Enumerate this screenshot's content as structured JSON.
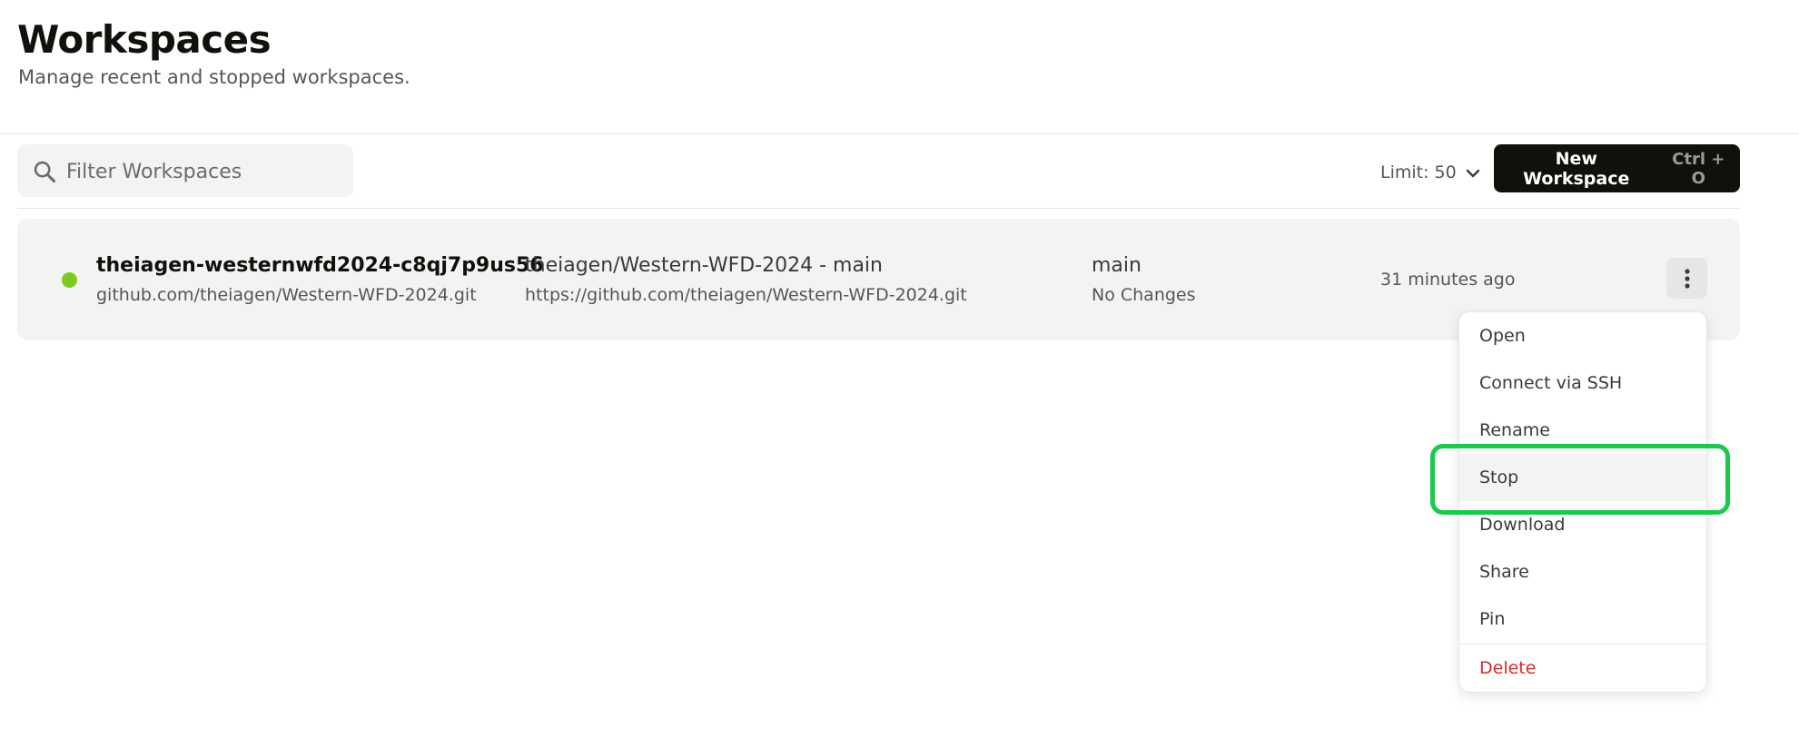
{
  "header": {
    "title": "Workspaces",
    "subtitle": "Manage recent and stopped workspaces."
  },
  "toolbar": {
    "filter_placeholder": "Filter Workspaces",
    "filter_icon": "search-icon",
    "limit_label": "Limit: 50",
    "limit_icon": "chevron-down-icon",
    "new_workspace_label": "New Workspace",
    "new_workspace_shortcut": "Ctrl + O"
  },
  "workspaces": [
    {
      "status": "running",
      "status_color": "#7ecb20",
      "name": "theiagen-westernwfd2024-c8qj7p9us56",
      "repo_url": "github.com/theiagen/Western-WFD-2024.git",
      "context": "theiagen/Western-WFD-2024 - main",
      "context_url": "https://github.com/theiagen/Western-WFD-2024.git",
      "branch": "main",
      "changes": "No Changes",
      "last_active": "31 minutes ago",
      "more_icon": "vertical-ellipsis-icon"
    }
  ],
  "context_menu": {
    "items": [
      {
        "label": "Open"
      },
      {
        "label": "Connect via SSH"
      },
      {
        "label": "Rename"
      },
      {
        "label": "Stop"
      },
      {
        "label": "Download"
      },
      {
        "label": "Share"
      },
      {
        "label": "Pin"
      },
      {
        "label": "Delete"
      }
    ],
    "hovered_item": "Stop",
    "danger_color": "#d12b2b"
  },
  "colors": {
    "accent_dark": "#12100c",
    "highlight_ring": "#19c94b",
    "card_background": "#f3f3f3"
  }
}
